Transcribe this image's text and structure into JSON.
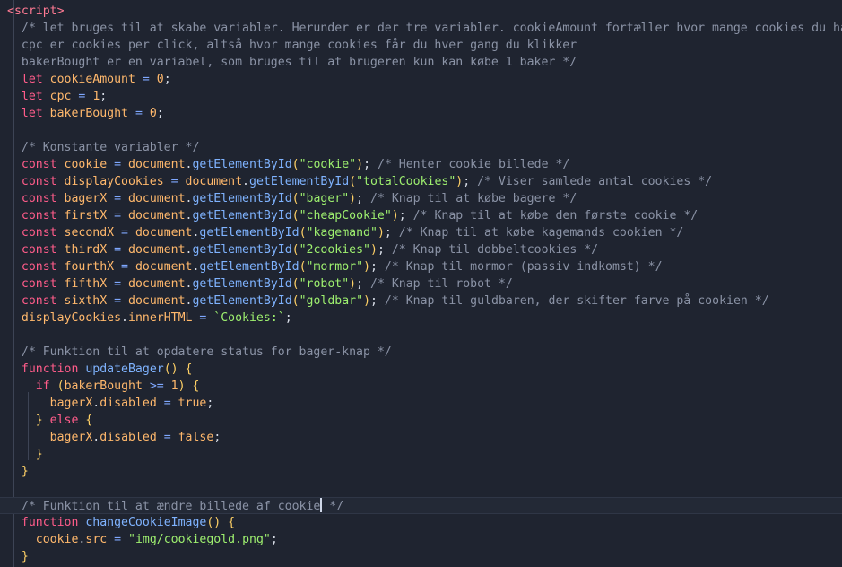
{
  "editor": {
    "colors": {
      "background": "#1f2430",
      "tag": "#ff7a93",
      "comment": "#8b93a6",
      "keyword": "#ff5c8a",
      "variable": "#ffb86c",
      "number": "#ffb86c",
      "string": "#9ef06f",
      "function": "#7fb3ff",
      "text": "#d7dce6",
      "punctuation": "#7fa8ff",
      "brace": "#ffd166"
    },
    "lines": [
      {
        "tokens": [
          [
            "tag",
            "<script>"
          ]
        ]
      },
      {
        "tokens": [
          [
            "comment",
            "/* let bruges til at skabe variabler. Herunder er der tre variabler. cookieAmount fortæller hvor mange cookies du har'"
          ]
        ]
      },
      {
        "tokens": [
          [
            "comment",
            "cpc er cookies per click, altså hvor mange cookies får du hver gang du klikker"
          ]
        ]
      },
      {
        "tokens": [
          [
            "comment",
            "bakerBought er en variabel, som bruges til at brugeren kun kan købe 1 baker */"
          ]
        ]
      },
      {
        "tokens": [
          [
            "keyword",
            "let "
          ],
          [
            "variable",
            "cookieAmount"
          ],
          [
            "punctuation",
            " = "
          ],
          [
            "number",
            "0"
          ],
          [
            "text",
            ";"
          ]
        ]
      },
      {
        "tokens": [
          [
            "keyword",
            "let "
          ],
          [
            "variable",
            "cpc"
          ],
          [
            "punctuation",
            " = "
          ],
          [
            "number",
            "1"
          ],
          [
            "text",
            ";"
          ]
        ]
      },
      {
        "tokens": [
          [
            "keyword",
            "let "
          ],
          [
            "variable",
            "bakerBought"
          ],
          [
            "punctuation",
            " = "
          ],
          [
            "number",
            "0"
          ],
          [
            "text",
            ";"
          ]
        ]
      },
      {
        "tokens": []
      },
      {
        "tokens": [
          [
            "comment",
            "/* Konstante variabler */"
          ]
        ]
      },
      {
        "tokens": [
          [
            "keyword",
            "const "
          ],
          [
            "variable",
            "cookie"
          ],
          [
            "punctuation",
            " = "
          ],
          [
            "variable",
            "document"
          ],
          [
            "text",
            "."
          ],
          [
            "function",
            "getElementById"
          ],
          [
            "brace",
            "("
          ],
          [
            "string",
            "\"cookie\""
          ],
          [
            "brace",
            ")"
          ],
          [
            "text",
            "; "
          ],
          [
            "comment",
            "/* Henter cookie billede */"
          ]
        ]
      },
      {
        "tokens": [
          [
            "keyword",
            "const "
          ],
          [
            "variable",
            "displayCookies"
          ],
          [
            "punctuation",
            " = "
          ],
          [
            "variable",
            "document"
          ],
          [
            "text",
            "."
          ],
          [
            "function",
            "getElementById"
          ],
          [
            "brace",
            "("
          ],
          [
            "string",
            "\"totalCookies\""
          ],
          [
            "brace",
            ")"
          ],
          [
            "text",
            "; "
          ],
          [
            "comment",
            "/* Viser samlede antal cookies */"
          ]
        ]
      },
      {
        "tokens": [
          [
            "keyword",
            "const "
          ],
          [
            "variable",
            "bagerX"
          ],
          [
            "punctuation",
            " = "
          ],
          [
            "variable",
            "document"
          ],
          [
            "text",
            "."
          ],
          [
            "function",
            "getElementById"
          ],
          [
            "brace",
            "("
          ],
          [
            "string",
            "\"bager\""
          ],
          [
            "brace",
            ")"
          ],
          [
            "text",
            "; "
          ],
          [
            "comment",
            "/* Knap til at købe bagere */"
          ]
        ]
      },
      {
        "tokens": [
          [
            "keyword",
            "const "
          ],
          [
            "variable",
            "firstX"
          ],
          [
            "punctuation",
            " = "
          ],
          [
            "variable",
            "document"
          ],
          [
            "text",
            "."
          ],
          [
            "function",
            "getElementById"
          ],
          [
            "brace",
            "("
          ],
          [
            "string",
            "\"cheapCookie\""
          ],
          [
            "brace",
            ")"
          ],
          [
            "text",
            "; "
          ],
          [
            "comment",
            "/* Knap til at købe den første cookie */"
          ]
        ]
      },
      {
        "tokens": [
          [
            "keyword",
            "const "
          ],
          [
            "variable",
            "secondX"
          ],
          [
            "punctuation",
            " = "
          ],
          [
            "variable",
            "document"
          ],
          [
            "text",
            "."
          ],
          [
            "function",
            "getElementById"
          ],
          [
            "brace",
            "("
          ],
          [
            "string",
            "\"kagemand\""
          ],
          [
            "brace",
            ")"
          ],
          [
            "text",
            "; "
          ],
          [
            "comment",
            "/* Knap til at købe kagemands cookien */"
          ]
        ]
      },
      {
        "tokens": [
          [
            "keyword",
            "const "
          ],
          [
            "variable",
            "thirdX"
          ],
          [
            "punctuation",
            " = "
          ],
          [
            "variable",
            "document"
          ],
          [
            "text",
            "."
          ],
          [
            "function",
            "getElementById"
          ],
          [
            "brace",
            "("
          ],
          [
            "string",
            "\"2cookies\""
          ],
          [
            "brace",
            ")"
          ],
          [
            "text",
            "; "
          ],
          [
            "comment",
            "/* Knap til dobbeltcookies */"
          ]
        ]
      },
      {
        "tokens": [
          [
            "keyword",
            "const "
          ],
          [
            "variable",
            "fourthX"
          ],
          [
            "punctuation",
            " = "
          ],
          [
            "variable",
            "document"
          ],
          [
            "text",
            "."
          ],
          [
            "function",
            "getElementById"
          ],
          [
            "brace",
            "("
          ],
          [
            "string",
            "\"mormor\""
          ],
          [
            "brace",
            ")"
          ],
          [
            "text",
            "; "
          ],
          [
            "comment",
            "/* Knap til mormor (passiv indkomst) */"
          ]
        ]
      },
      {
        "tokens": [
          [
            "keyword",
            "const "
          ],
          [
            "variable",
            "fifthX"
          ],
          [
            "punctuation",
            " = "
          ],
          [
            "variable",
            "document"
          ],
          [
            "text",
            "."
          ],
          [
            "function",
            "getElementById"
          ],
          [
            "brace",
            "("
          ],
          [
            "string",
            "\"robot\""
          ],
          [
            "brace",
            ")"
          ],
          [
            "text",
            "; "
          ],
          [
            "comment",
            "/* Knap til robot */"
          ]
        ]
      },
      {
        "tokens": [
          [
            "keyword",
            "const "
          ],
          [
            "variable",
            "sixthX"
          ],
          [
            "punctuation",
            " = "
          ],
          [
            "variable",
            "document"
          ],
          [
            "text",
            "."
          ],
          [
            "function",
            "getElementById"
          ],
          [
            "brace",
            "("
          ],
          [
            "string",
            "\"goldbar\""
          ],
          [
            "brace",
            ")"
          ],
          [
            "text",
            "; "
          ],
          [
            "comment",
            "/* Knap til guldbaren, der skifter farve på cookien */"
          ]
        ]
      },
      {
        "tokens": [
          [
            "variable",
            "displayCookies"
          ],
          [
            "text",
            "."
          ],
          [
            "variable",
            "innerHTML"
          ],
          [
            "punctuation",
            " = "
          ],
          [
            "string",
            "`Cookies:`"
          ],
          [
            "text",
            ";"
          ]
        ]
      },
      {
        "tokens": []
      },
      {
        "tokens": [
          [
            "comment",
            "/* Funktion til at opdatere status for bager-knap */"
          ]
        ]
      },
      {
        "tokens": [
          [
            "keyword",
            "function "
          ],
          [
            "function",
            "updateBager"
          ],
          [
            "brace",
            "() {"
          ]
        ]
      },
      {
        "tokens": [
          [
            "text",
            "  "
          ],
          [
            "keyword",
            "if "
          ],
          [
            "brace",
            "("
          ],
          [
            "variable",
            "bakerBought"
          ],
          [
            "punctuation",
            " >= "
          ],
          [
            "number",
            "1"
          ],
          [
            "brace",
            ") {"
          ]
        ]
      },
      {
        "tokens": [
          [
            "text",
            "    "
          ],
          [
            "variable",
            "bagerX"
          ],
          [
            "text",
            "."
          ],
          [
            "variable",
            "disabled"
          ],
          [
            "punctuation",
            " = "
          ],
          [
            "number",
            "true"
          ],
          [
            "text",
            ";"
          ]
        ]
      },
      {
        "tokens": [
          [
            "text",
            "  "
          ],
          [
            "brace",
            "} "
          ],
          [
            "keyword",
            "else "
          ],
          [
            "brace",
            "{"
          ]
        ]
      },
      {
        "tokens": [
          [
            "text",
            "    "
          ],
          [
            "variable",
            "bagerX"
          ],
          [
            "text",
            "."
          ],
          [
            "variable",
            "disabled"
          ],
          [
            "punctuation",
            " = "
          ],
          [
            "number",
            "false"
          ],
          [
            "text",
            ";"
          ]
        ]
      },
      {
        "tokens": [
          [
            "text",
            "  "
          ],
          [
            "brace",
            "}"
          ]
        ]
      },
      {
        "tokens": [
          [
            "brace",
            "}"
          ]
        ]
      },
      {
        "tokens": []
      },
      {
        "tokens": [
          [
            "comment",
            "/* Funktion til at ændre billede af cookie"
          ],
          [
            "caret",
            ""
          ],
          [
            "comment",
            " */"
          ]
        ],
        "current": true
      },
      {
        "tokens": [
          [
            "keyword",
            "function "
          ],
          [
            "function",
            "changeCookieImage"
          ],
          [
            "brace",
            "() {"
          ]
        ]
      },
      {
        "tokens": [
          [
            "text",
            "  "
          ],
          [
            "variable",
            "cookie"
          ],
          [
            "text",
            "."
          ],
          [
            "variable",
            "src"
          ],
          [
            "punctuation",
            " = "
          ],
          [
            "string",
            "\"img/cookiegold.png\""
          ],
          [
            "text",
            ";"
          ]
        ]
      },
      {
        "tokens": [
          [
            "brace",
            "}"
          ]
        ]
      }
    ]
  }
}
